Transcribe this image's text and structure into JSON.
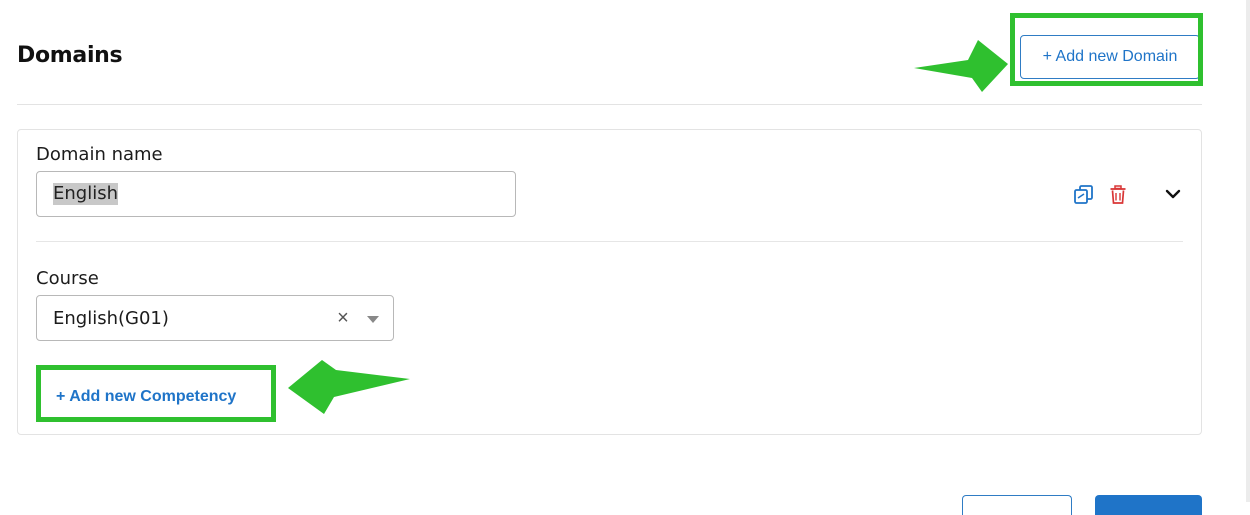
{
  "header": {
    "title": "Domains",
    "add_domain_label": "+ Add new Domain"
  },
  "domain_card": {
    "domain_name_label": "Domain name",
    "domain_name_value": "English",
    "course_label": "Course",
    "course_value": "English(G01)",
    "clear_glyph": "×",
    "add_competency_label": "+ Add new Competency"
  },
  "icons": {
    "copy": "copy-icon",
    "delete": "trash-icon",
    "expand": "chevron-down-icon",
    "annotation_arrow": "arrow-icon"
  },
  "colors": {
    "accent": "#1f74c8",
    "annotation": "#2fc02f",
    "danger": "#d93636"
  }
}
